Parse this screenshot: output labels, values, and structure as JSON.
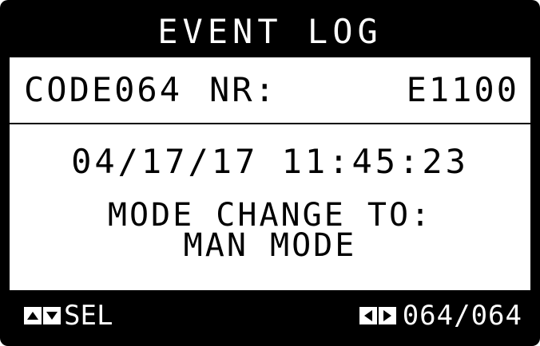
{
  "header": {
    "title": "EVENT LOG"
  },
  "event": {
    "code": "CODE064",
    "nr_label": "NR:",
    "event_id": "E1100",
    "datetime": "04/17/17 11:45:23",
    "message_line1": "MODE CHANGE TO:",
    "message_line2": "MAN MODE"
  },
  "footer": {
    "up_icon": "triangle-up-icon",
    "down_icon": "triangle-down-icon",
    "select_label": "SEL",
    "left_icon": "triangle-left-icon",
    "right_icon": "triangle-right-icon",
    "page_indicator": "064/064"
  },
  "colors": {
    "background": "#000000",
    "foreground": "#ffffff",
    "text": "#000000"
  }
}
